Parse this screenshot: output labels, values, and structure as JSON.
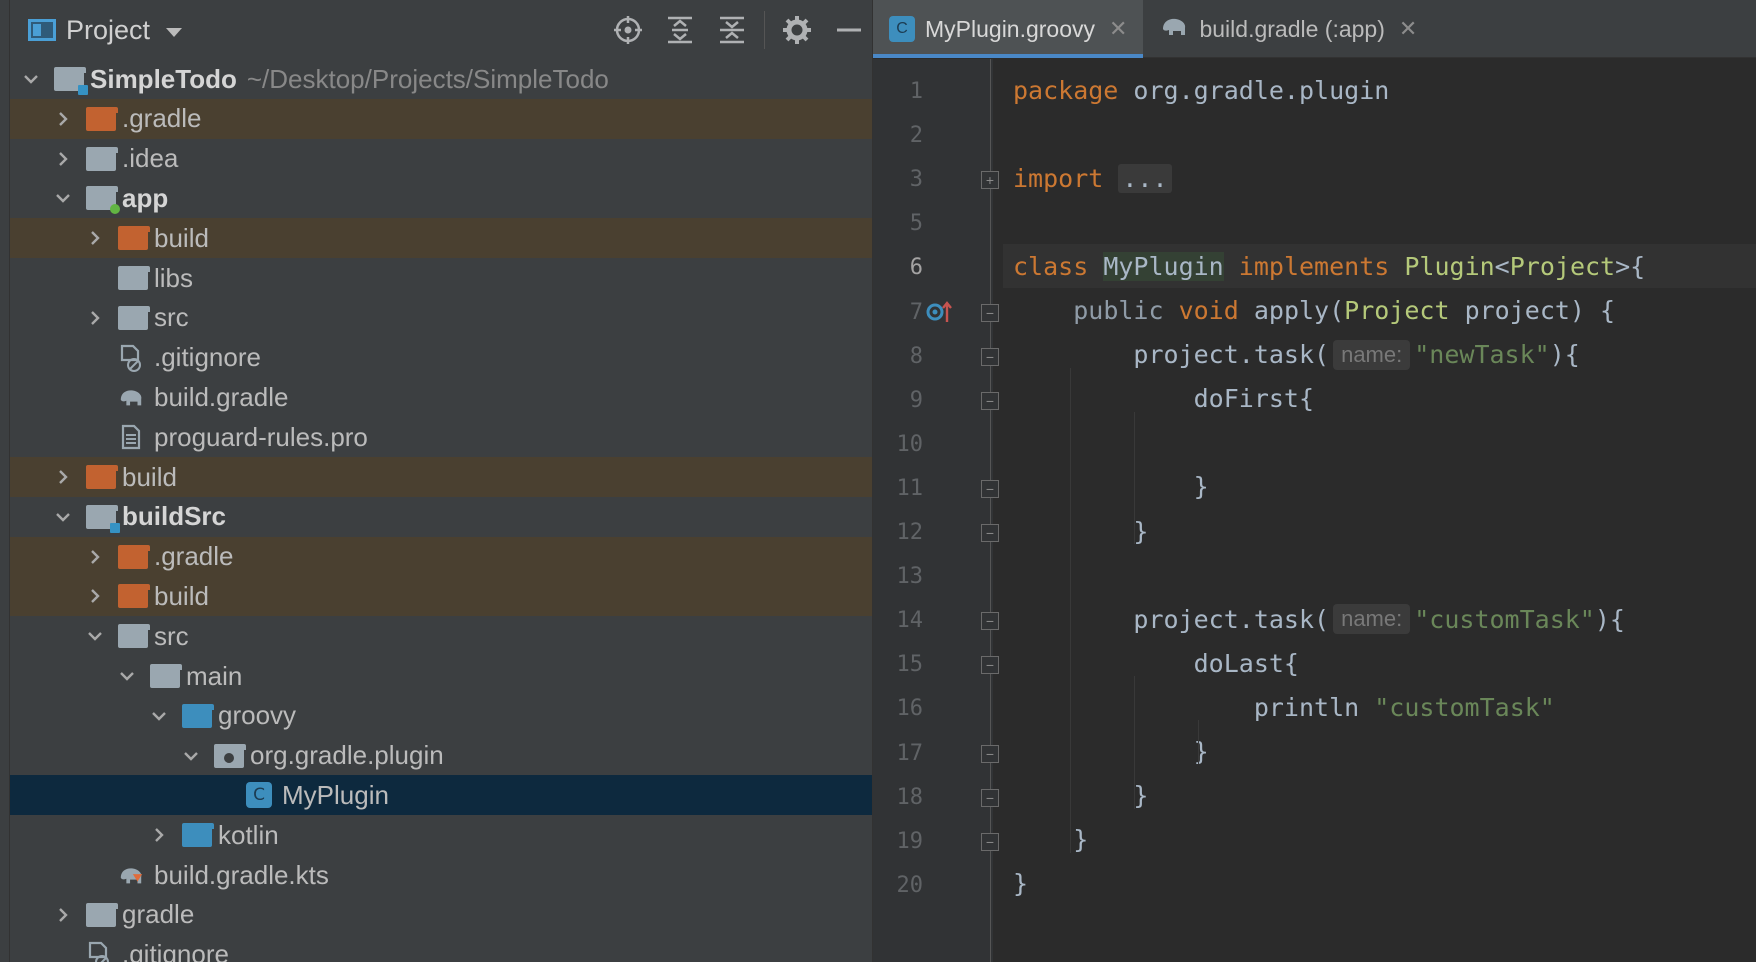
{
  "panel": {
    "title": "Project",
    "tools": [
      "locate-icon",
      "expand-all-icon",
      "collapse-all-icon",
      "gear-icon",
      "minimize-icon"
    ]
  },
  "tree": [
    {
      "label": "SimpleTodo",
      "path": "~/Desktop/Projects/SimpleTodo",
      "depth": 0,
      "arrow": "down",
      "icon": "module-blue",
      "bold": true,
      "excluded": false
    },
    {
      "label": ".gradle",
      "depth": 1,
      "arrow": "right",
      "icon": "folder-orange",
      "excluded": true
    },
    {
      "label": ".idea",
      "depth": 1,
      "arrow": "right",
      "icon": "folder-grey",
      "excluded": false
    },
    {
      "label": "app",
      "depth": 1,
      "arrow": "down",
      "icon": "module-green",
      "bold": true,
      "excluded": false
    },
    {
      "label": "build",
      "depth": 2,
      "arrow": "right",
      "icon": "folder-orange",
      "excluded": true
    },
    {
      "label": "libs",
      "depth": 2,
      "arrow": "none",
      "icon": "folder-grey",
      "excluded": false
    },
    {
      "label": "src",
      "depth": 2,
      "arrow": "right",
      "icon": "folder-grey",
      "excluded": false
    },
    {
      "label": ".gitignore",
      "depth": 2,
      "arrow": "none",
      "icon": "gitignore-file",
      "excluded": false
    },
    {
      "label": "build.gradle",
      "depth": 2,
      "arrow": "none",
      "icon": "gradle-file",
      "excluded": false
    },
    {
      "label": "proguard-rules.pro",
      "depth": 2,
      "arrow": "none",
      "icon": "text-file",
      "excluded": false
    },
    {
      "label": "build",
      "depth": 1,
      "arrow": "right",
      "icon": "folder-orange",
      "excluded": true
    },
    {
      "label": "buildSrc",
      "depth": 1,
      "arrow": "down",
      "icon": "module-blue",
      "bold": true,
      "excluded": false
    },
    {
      "label": ".gradle",
      "depth": 2,
      "arrow": "right",
      "icon": "folder-orange",
      "excluded": true
    },
    {
      "label": "build",
      "depth": 2,
      "arrow": "right",
      "icon": "folder-orange",
      "excluded": true
    },
    {
      "label": "src",
      "depth": 2,
      "arrow": "down",
      "icon": "folder-grey",
      "excluded": false
    },
    {
      "label": "main",
      "depth": 3,
      "arrow": "down",
      "icon": "folder-grey",
      "excluded": false
    },
    {
      "label": "groovy",
      "depth": 4,
      "arrow": "down",
      "icon": "folder-blue",
      "excluded": false
    },
    {
      "label": "org.gradle.plugin",
      "depth": 5,
      "arrow": "down",
      "icon": "package",
      "excluded": false
    },
    {
      "label": "MyPlugin",
      "depth": 6,
      "arrow": "none",
      "icon": "groovy-class",
      "excluded": false,
      "selected": true
    },
    {
      "label": "kotlin",
      "depth": 4,
      "arrow": "right",
      "icon": "folder-blue",
      "excluded": false
    },
    {
      "label": "build.gradle.kts",
      "depth": 2,
      "arrow": "none",
      "icon": "gradle-kts-file",
      "excluded": false
    },
    {
      "label": "gradle",
      "depth": 1,
      "arrow": "right",
      "icon": "folder-grey",
      "excluded": false
    },
    {
      "label": ".gitignore",
      "depth": 1,
      "arrow": "none",
      "icon": "gitignore-file",
      "excluded": false
    }
  ],
  "tabs": [
    {
      "label": "MyPlugin.groovy",
      "icon": "groovy-class-icon",
      "active": true
    },
    {
      "label": "build.gradle (:app)",
      "icon": "gradle-elephant-icon",
      "active": false
    }
  ],
  "editor": {
    "current_line": 6,
    "lines": [
      {
        "num": "1",
        "tokens": [
          [
            "kw",
            "package "
          ],
          [
            "pl",
            "org.gradle.plugin"
          ]
        ]
      },
      {
        "num": "2",
        "tokens": []
      },
      {
        "num": "3",
        "tokens": [
          [
            "kw",
            "import "
          ],
          [
            "folded",
            "..."
          ]
        ]
      },
      {
        "num": "5",
        "tokens": []
      },
      {
        "num": "6",
        "tokens": [
          [
            "kw",
            "class "
          ],
          [
            "hl-name",
            "MyPlugin"
          ],
          [
            "kw",
            " implements "
          ],
          [
            "cls",
            "Plugin"
          ],
          [
            "pl",
            "<"
          ],
          [
            "cls",
            "Project"
          ],
          [
            "pl",
            ">{"
          ]
        ]
      },
      {
        "num": "7",
        "tokens": [
          [
            "pl",
            "    "
          ],
          [
            "mod",
            "public "
          ],
          [
            "kw",
            "void "
          ],
          [
            "pl",
            "apply("
          ],
          [
            "cls",
            "Project"
          ],
          [
            "pl",
            " project) {"
          ]
        ]
      },
      {
        "num": "8",
        "tokens": [
          [
            "pl",
            "        project.task("
          ],
          [
            "hint",
            "name:"
          ],
          [
            "str",
            "\"newTask\""
          ],
          [
            "pl",
            "){"
          ]
        ]
      },
      {
        "num": "9",
        "tokens": [
          [
            "pl",
            "            doFirst{"
          ]
        ]
      },
      {
        "num": "10",
        "tokens": []
      },
      {
        "num": "11",
        "tokens": [
          [
            "pl",
            "            }"
          ]
        ]
      },
      {
        "num": "12",
        "tokens": [
          [
            "pl",
            "        }"
          ]
        ]
      },
      {
        "num": "13",
        "tokens": []
      },
      {
        "num": "14",
        "tokens": [
          [
            "pl",
            "        project.task("
          ],
          [
            "hint",
            "name:"
          ],
          [
            "str",
            "\"customTask\""
          ],
          [
            "pl",
            "){"
          ]
        ]
      },
      {
        "num": "15",
        "tokens": [
          [
            "pl",
            "            doLast{"
          ]
        ]
      },
      {
        "num": "16",
        "tokens": [
          [
            "pl",
            "                println "
          ],
          [
            "str",
            "\"customTask\""
          ]
        ]
      },
      {
        "num": "17",
        "tokens": [
          [
            "pl",
            "            }"
          ]
        ]
      },
      {
        "num": "18",
        "tokens": [
          [
            "pl",
            "        }"
          ]
        ]
      },
      {
        "num": "19",
        "tokens": [
          [
            "pl",
            "    }"
          ]
        ]
      },
      {
        "num": "20",
        "tokens": [
          [
            "pl",
            "}"
          ]
        ]
      }
    ]
  },
  "colors": {
    "keyword": "#cc7832",
    "class": "#b5c97a",
    "string": "#6a8759",
    "excluded_bg": "#4a4030",
    "selected_bg": "#0d293e",
    "accent": "#4a88c7"
  }
}
